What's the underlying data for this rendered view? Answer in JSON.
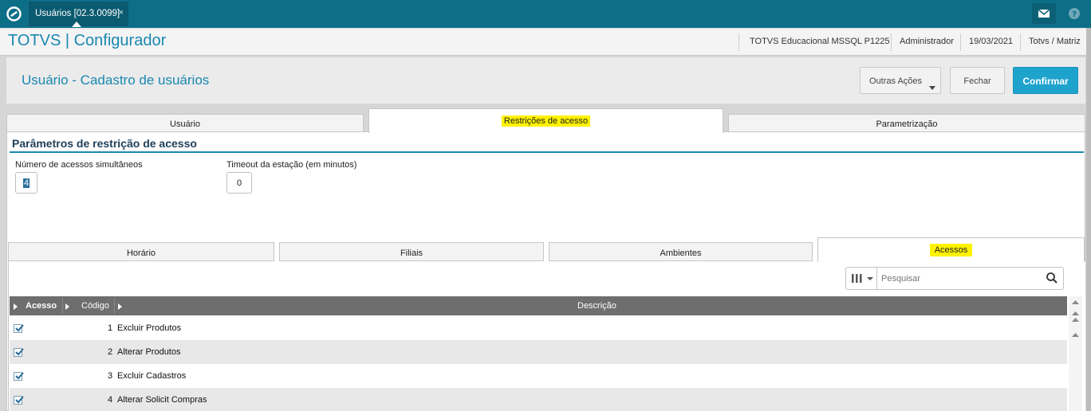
{
  "topbar": {
    "tab_title": "Usuários [02.3.0099]",
    "tab_close": "×",
    "icons": [
      "totvs-logo-icon",
      "close-icon",
      "mail-icon",
      "help-icon"
    ]
  },
  "header": {
    "app_title": "TOTVS | Configurador",
    "environment": "TOTVS Educacional MSSQL P1225",
    "user": "Administrador",
    "date": "19/03/2021",
    "branch": "Totvs / Matriz"
  },
  "form": {
    "title": "Usuário - Cadastro de usuários",
    "actions": {
      "outras": "Outras Ações",
      "fechar": "Fechar",
      "confirmar": "Confirmar"
    }
  },
  "main_tabs": [
    {
      "label": "Usuário",
      "active": false
    },
    {
      "label": "Restrições de acesso",
      "active": true,
      "highlighted": true
    },
    {
      "label": "Parametrização",
      "active": false
    }
  ],
  "section": {
    "title": "Parâmetros de restrição de acesso",
    "fields": [
      {
        "label": "Número de acessos simultâneos",
        "value": "4"
      },
      {
        "label": "Timeout da estação (em minutos)",
        "value": "0"
      }
    ]
  },
  "sub_tabs": [
    {
      "label": "Horário",
      "active": false
    },
    {
      "label": "Filiais",
      "active": false
    },
    {
      "label": "Ambientes",
      "active": false
    },
    {
      "label": "Acessos",
      "active": true,
      "highlighted": true
    }
  ],
  "search": {
    "placeholder": "Pesquisar"
  },
  "grid": {
    "columns": [
      "Acesso",
      "Código",
      "Descrição"
    ],
    "rows": [
      {
        "checked": true,
        "code": "1",
        "description": "Excluir Produtos"
      },
      {
        "checked": true,
        "code": "2",
        "description": "Alterar Produtos"
      },
      {
        "checked": true,
        "code": "3",
        "description": "Excluir Cadastros"
      },
      {
        "checked": true,
        "code": "4",
        "description": "Alterar Solicit Compras"
      }
    ]
  },
  "colors": {
    "topbar": "#0d6e88",
    "accent": "#1a88b0",
    "confirm": "#1ea3cd",
    "highlight": "#fff200",
    "grid_header": "#6e6e6e"
  }
}
